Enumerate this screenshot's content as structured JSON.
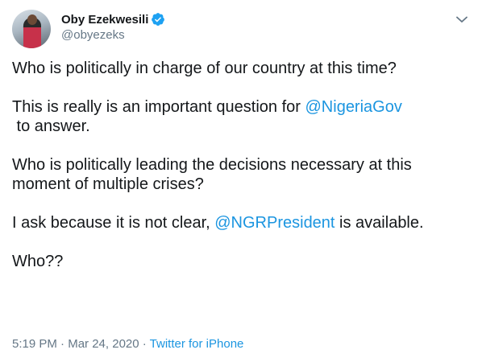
{
  "user": {
    "display_name": "Oby Ezekwesili",
    "handle": "@obyezeks"
  },
  "tweet": {
    "line1": "Who is politically in charge of our country at this time?",
    "line2_prefix": "This is really is an important question for ",
    "line2_mention": "@NigeriaGov",
    "line3": " to answer.",
    "line4": "Who is politically leading the decisions necessary at this",
    "line5": "moment of multiple crises?",
    "line6_prefix": "I ask because it is not clear, ",
    "line6_mention": "@NGRPresident",
    "line6_suffix": " is available.",
    "line7": "Who??"
  },
  "meta": {
    "time": "5:19 PM",
    "separator1": " · ",
    "date": "Mar 24, 2020",
    "separator2": " · ",
    "source": "Twitter for iPhone"
  },
  "colors": {
    "link": "#1b95e0",
    "muted": "#657786",
    "text": "#14171a",
    "verified": "#1da1f2"
  },
  "icons": {
    "verified": "verified-badge-icon",
    "caret": "chevron-down-icon"
  }
}
